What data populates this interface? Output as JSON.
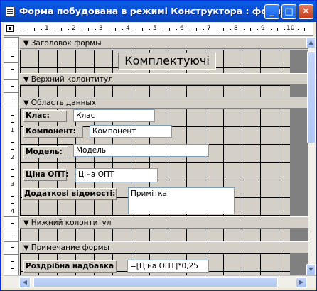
{
  "window": {
    "title": "Форма побудована в режимі  Конструктора : форма",
    "minimize": "_",
    "maximize": "□",
    "close": "✕"
  },
  "ruler": {
    "numbers": [
      "1",
      "2",
      "3",
      "4",
      "5",
      "6",
      "7",
      "8",
      "9",
      "10"
    ],
    "vertical_numbers": [
      "1",
      "2",
      "3",
      "4"
    ]
  },
  "sections": {
    "form_header": "Заголовок формы",
    "page_header": "Верхний колонтитул",
    "detail": "Область данных",
    "page_footer": "Нижний колонтитул",
    "form_footer": "Примечание формы"
  },
  "header": {
    "title": "Комплектуючі"
  },
  "fields": [
    {
      "label": "Клас:",
      "value": "Клас"
    },
    {
      "label": "Компонент:",
      "value": "Компонент"
    },
    {
      "label": "Модель:",
      "value": "Модель"
    },
    {
      "label": "Ціна ОПТ:",
      "value": "Ціна ОПТ"
    },
    {
      "label": "Додаткові відомості:",
      "value": "Примітка"
    }
  ],
  "footer_field": {
    "label": "Роздрібна надбавка",
    "value": "=[Ціна ОПТ]*0,25"
  },
  "icons": {
    "section_arrow": "▼",
    "selector": "■"
  }
}
